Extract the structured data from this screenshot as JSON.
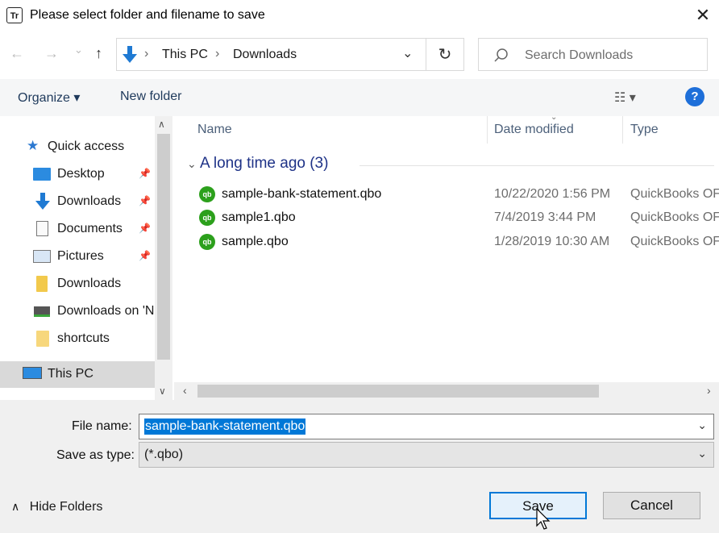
{
  "window": {
    "title": "Please select folder and filename to save",
    "app_icon": "Tr",
    "close_glyph": "✕"
  },
  "nav": {
    "back_glyph": "←",
    "forward_glyph": "→",
    "recent_glyph": "⌄",
    "up_glyph": "↑",
    "address_parts": [
      "This PC",
      "Downloads"
    ],
    "address_sep": "›",
    "refresh_glyph": "↻",
    "search_placeholder": "Search Downloads"
  },
  "toolbar": {
    "organize": "Organize ▾",
    "new_folder": "New folder",
    "view_glyph": "☷ ▾",
    "help": "?"
  },
  "sidebar": {
    "items": [
      {
        "label": "Quick access",
        "icon": "star-icon",
        "pinned": false
      },
      {
        "label": "Desktop",
        "icon": "desktop-icon",
        "pinned": true
      },
      {
        "label": "Downloads",
        "icon": "download-arrow-icon",
        "pinned": true
      },
      {
        "label": "Documents",
        "icon": "document-icon",
        "pinned": true
      },
      {
        "label": "Pictures",
        "icon": "pictures-icon",
        "pinned": true
      },
      {
        "label": "Downloads",
        "icon": "folder-icon",
        "pinned": false
      },
      {
        "label": "Downloads on 'N",
        "icon": "network-drive-icon",
        "pinned": false
      },
      {
        "label": "shortcuts",
        "icon": "folder-icon",
        "pinned": false
      },
      {
        "label": "This PC",
        "icon": "computer-icon",
        "pinned": false
      }
    ],
    "pin_glyph": "📌"
  },
  "columns": {
    "name": "Name",
    "date": "Date modified",
    "type": "Type"
  },
  "group": {
    "label": "A long time ago (3)"
  },
  "files": [
    {
      "name": "sample-bank-statement.qbo",
      "date": "10/22/2020 1:56 PM",
      "type": "QuickBooks OFX"
    },
    {
      "name": "sample1.qbo",
      "date": "7/4/2019 3:44 PM",
      "type": "QuickBooks OFX"
    },
    {
      "name": "sample.qbo",
      "date": "1/28/2019 10:30 AM",
      "type": "QuickBooks OFX"
    }
  ],
  "file_icon_text": "qb",
  "form": {
    "filename_label": "File name:",
    "filename_value": "sample-bank-statement.qbo",
    "savetype_label": "Save as type:",
    "savetype_value": "(*.qbo)",
    "dropdown_glyph": "⌄"
  },
  "footer": {
    "hide_folders": "Hide Folders",
    "hide_glyph": "∧",
    "save": "Save",
    "cancel": "Cancel"
  },
  "colors": {
    "accent": "#0078d7",
    "qb_green": "#2ca01c",
    "group_blue": "#1e3287"
  }
}
